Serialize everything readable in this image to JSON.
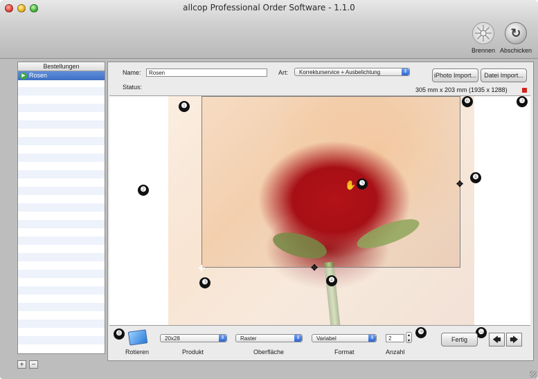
{
  "window": {
    "title": "allcop Professional Order Software - 1.1.0"
  },
  "toolbar": {
    "brennen_label": "Brennen",
    "abschicken_label": "Abschicken"
  },
  "sidebar": {
    "header": "Bestellungen",
    "items": [
      {
        "label": "Rosen",
        "icon": "play-icon",
        "status_color": "#3aa93a"
      }
    ],
    "add_label": "+",
    "remove_label": "−"
  },
  "order": {
    "name_label": "Name:",
    "name_value": "Rosen",
    "art_label": "Art:",
    "art_value": "Korrekturservice + Ausbelichtung",
    "status_label": "Status:",
    "iphoto_button": "iPhoto Import...",
    "datei_button": "Datei Import...",
    "dimensions": "305 mm x 203 mm (1935 x 1288)",
    "warning_color": "#d0241c"
  },
  "markers": {
    "m1": "❶",
    "m2": "❷",
    "m3": "❸",
    "m4a": "❹",
    "m4b": "❹",
    "m5": "❺",
    "m6": "❻",
    "m7": "❼",
    "m8": "❽",
    "m9": "❾",
    "m10": "❿"
  },
  "bottom": {
    "rotieren_label": "Rotieren",
    "produkt_label": "Produkt",
    "produkt_value": "20x28",
    "oberflaeche_label": "Oberfläche",
    "oberflaeche_value": "Raster",
    "format_label": "Format",
    "format_value": "Variabel",
    "anzahl_label": "Anzahl",
    "anzahl_value": "2",
    "fertig_button": "Fertig",
    "prev_label": "🡄",
    "next_label": "🡆"
  }
}
